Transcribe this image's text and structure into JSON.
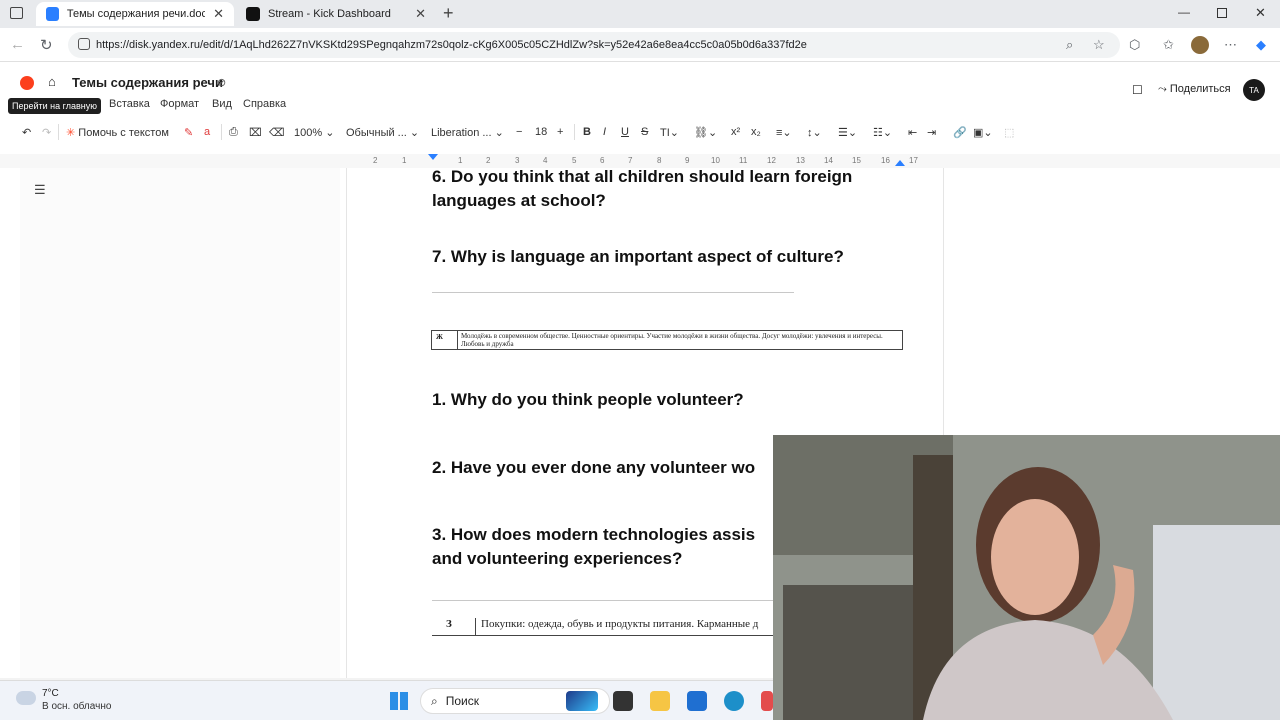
{
  "browser": {
    "tabs": [
      {
        "title": "Темы содержания речи.docx - Я",
        "active": true
      },
      {
        "title": "Stream - Kick Dashboard",
        "active": false
      }
    ],
    "url": "https://disk.yandex.ru/edit/d/1AqLhd262Z7nVKSKtd29SPegnqahzm72s0qolz-cKg6X005c05CZHdlZw?sk=y52e42a6e8ea4cc5c0a05b0d6a337fd2e"
  },
  "doc": {
    "title": "Темы содержания речи",
    "share_label": "Поделиться",
    "avatar": "TA",
    "tooltip": "Перейти на главную",
    "menu": [
      "Вставка",
      "Формат",
      "Вид",
      "Справка"
    ],
    "toolbar": {
      "assist": "Помочь с текстом",
      "zoom": "100%",
      "style": "Обычный ...",
      "font": "Liberation ...",
      "size": "18"
    },
    "ruler": [
      "2",
      "1",
      "1",
      "2",
      "3",
      "4",
      "5",
      "6",
      "7",
      "8",
      "9",
      "10",
      "11",
      "12",
      "13",
      "14",
      "15",
      "16",
      "17"
    ],
    "content": {
      "q6": "6. Do you think that all children should learn foreign languages at school?",
      "q7": "7. Why is language an important aspect of culture?",
      "table1_letter": "Ж",
      "table1_text": "Молодёжь в современном обществе. Ценностные ориентиры. Участие молодёжи в жизни общества. Досуг молодёжи: увлечения и интересы. Любовь и дружба",
      "v1": "1. Why do you think people volunteer?",
      "v2": "2. Have you ever done any volunteer wo",
      "v3": "3. How does modern technologies assis and volunteering experiences?",
      "table2_letter": "З",
      "table2_text": "Покупки: одежда, обувь и продукты питания. Карманные д"
    }
  },
  "taskbar": {
    "temp": "7°C",
    "weather": "В осн. облачно",
    "search": "Поиск"
  }
}
